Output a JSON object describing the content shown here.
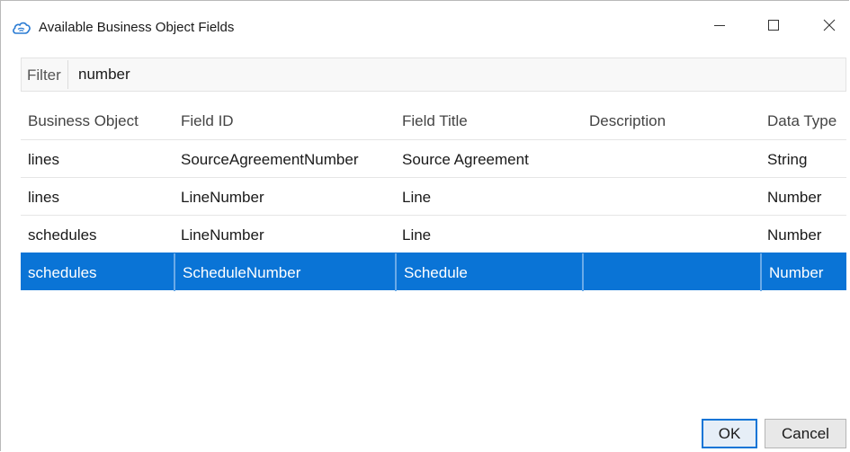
{
  "window": {
    "title": "Available Business Object Fields",
    "icon": "cloud-icon",
    "controls": {
      "minimize": "minimize-icon",
      "maximize": "maximize-icon",
      "close": "close-icon"
    }
  },
  "filter": {
    "label": "Filter",
    "value": "number"
  },
  "table": {
    "columns": [
      "Business Object",
      "Field ID",
      "Field Title",
      "Description",
      "Data Type"
    ],
    "rows": [
      {
        "business_object": "lines",
        "field_id": "SourceAgreementNumber",
        "field_title": "Source Agreement",
        "description": "",
        "data_type": "String",
        "selected": false
      },
      {
        "business_object": "lines",
        "field_id": "LineNumber",
        "field_title": "Line",
        "description": "",
        "data_type": "Number",
        "selected": false
      },
      {
        "business_object": "schedules",
        "field_id": "LineNumber",
        "field_title": "Line",
        "description": "",
        "data_type": "Number",
        "selected": false
      },
      {
        "business_object": "schedules",
        "field_id": "ScheduleNumber",
        "field_title": "Schedule",
        "description": "",
        "data_type": "Number",
        "selected": true
      }
    ]
  },
  "buttons": {
    "ok": "OK",
    "cancel": "Cancel"
  },
  "colors": {
    "selection": "#0a74d6"
  }
}
